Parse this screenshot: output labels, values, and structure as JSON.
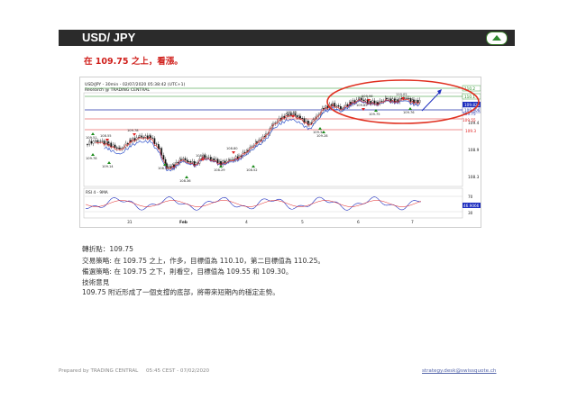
{
  "header": {
    "title": "USD/ JPY",
    "nav_icon": "up-triangle-icon"
  },
  "headline": "在 109.75 之上，看漲。",
  "chart": {
    "title_line1": "USD/JPY - 30min - 02/07/2020 05:38:42 (UTC+1)",
    "title_line2": "Research @ TRADING CENTRAL",
    "rsi_label": "RSI 4 - 9MA",
    "x_ticks": [
      "31",
      "Feb",
      "4",
      "5",
      "6",
      "7"
    ],
    "price_axis_labels": [
      "110.0",
      "109.4",
      "108.9",
      "108.3"
    ],
    "level_tags": [
      "110.2",
      "110.1",
      "109.821",
      "109.906",
      "109.75",
      "109.55",
      "109.3"
    ],
    "rsi_axis_labels": [
      "70",
      "46.9066",
      "30"
    ],
    "annotations": [
      "109.51",
      "109.78",
      "108.55",
      "109.14",
      "109.78",
      "108.25",
      "108.36",
      "108.70",
      "108.29",
      "108.80",
      "108.52",
      "109.55",
      "109.34",
      "109.28",
      "109.85",
      "109.96",
      "109.75",
      "110.02",
      "109.76"
    ],
    "colors": {
      "support": "#1a8a1a",
      "resistance": "#e02020",
      "pivot": "#2233aa",
      "ma": "#3355cc",
      "highlight": "#e03020",
      "arrow": "#1f2fbf"
    }
  },
  "info": {
    "pivot": "轉折點：109.75",
    "strategy": "交易策略: 在 109.75 之上，作多，目標值為 110.10，第二目標值為 110.25。",
    "alt_strategy": "備選策略: 在 109.75 之下，則看空，目標值為 109.55 和 109.30。",
    "commentary_title": "技術意見",
    "commentary": "109.75 附近形成了一個支撐的底部，將帶來短期內的穩定走勢。"
  },
  "footer": {
    "prepared_by": "Prepared by TRADING CENTRAL",
    "time": "05:45 CEST - 07/02/2020",
    "email": "strategy.desk@swissquote.ch"
  }
}
